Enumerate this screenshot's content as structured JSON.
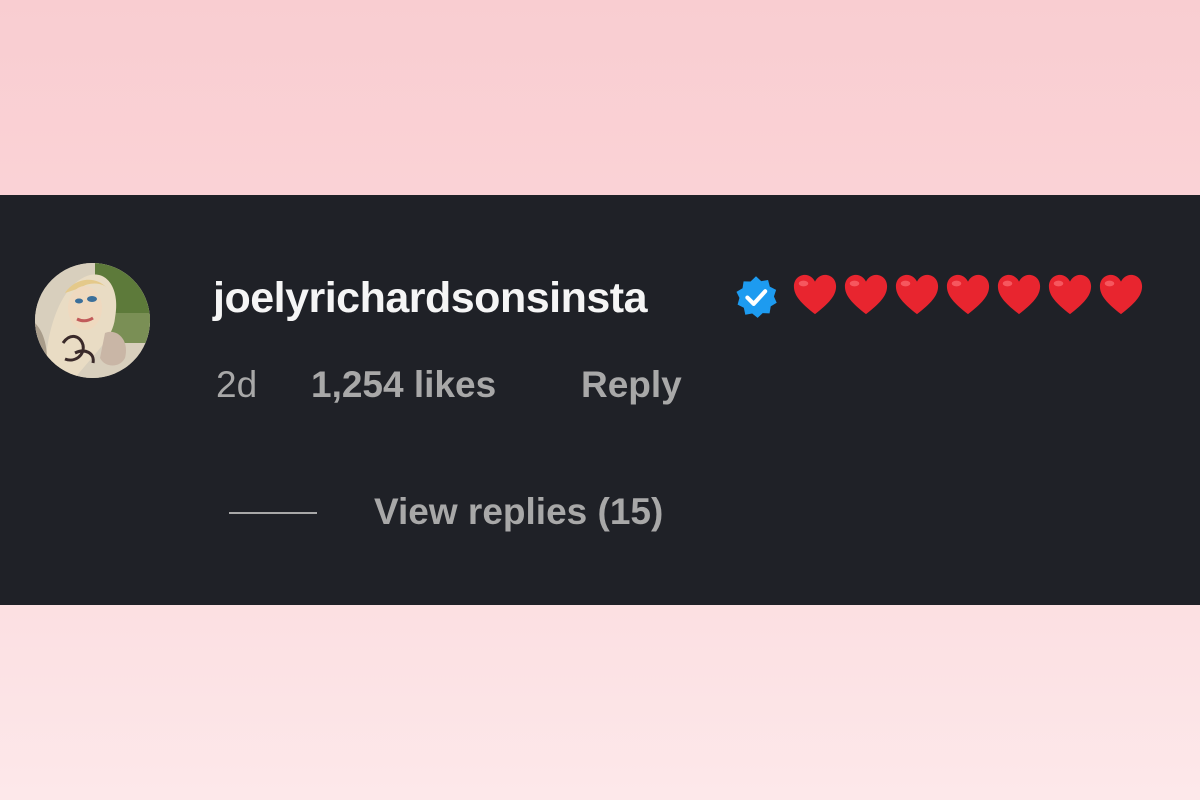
{
  "comment": {
    "username": "joelyrichardsonsinsta",
    "verified_icon": "verified-badge-icon",
    "emoji_text": "❤️❤️❤️❤️❤️❤️❤️",
    "heart_count": 7,
    "timestamp": "2d",
    "likes": "1,254 likes",
    "reply_label": "Reply",
    "view_replies_label": "View replies (15)"
  },
  "colors": {
    "background_pink": "#f9cdd1",
    "panel": "#1f2127",
    "username": "#f5f5f5",
    "secondary_text": "#a8a8a8",
    "verified_blue": "#1d9bf0",
    "heart_red": "#e8252f"
  }
}
